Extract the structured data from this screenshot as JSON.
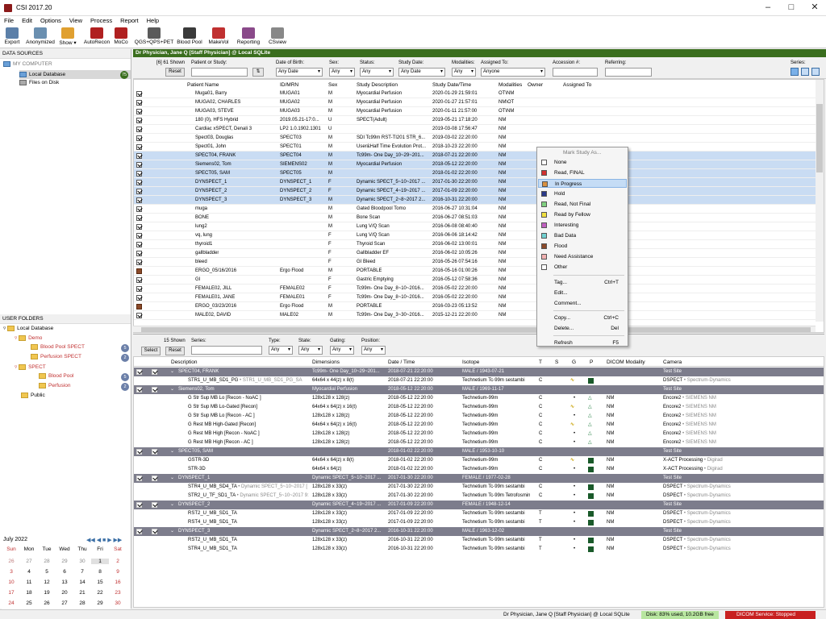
{
  "window": {
    "title": "CSI 2017.20"
  },
  "menu": [
    "File",
    "Edit",
    "Options",
    "View",
    "Process",
    "Report",
    "Help"
  ],
  "toolbar": [
    {
      "label": "Export",
      "color": "#5b7fa8"
    },
    {
      "label": "Anonymized",
      "color": "#6a8fb0"
    },
    {
      "label": "Show",
      "color": "#e0a030"
    },
    {
      "label": "AutoRecon",
      "color": "#b02020"
    },
    {
      "label": "MoCo",
      "color": "#b02020"
    },
    {
      "label": "QGS+QPS+PET",
      "color": "#5a5a5a"
    },
    {
      "label": "Blood Pool",
      "color": "#3a3a3a"
    },
    {
      "label": "MakeVol",
      "color": "#c03030"
    },
    {
      "label": "Reporting",
      "color": "#8a4a8a"
    },
    {
      "label": "CSview",
      "color": "#888"
    }
  ],
  "left": {
    "data_sources": "DATA SOURCES",
    "my_computer": "MY COMPUTER",
    "local_db": "Local Database",
    "local_db_count": "75",
    "files_on_disk": "Files on Disk",
    "user_folders": "USER FOLDERS",
    "folders": [
      {
        "label": "Local Database",
        "lvl": 0
      },
      {
        "label": "Demo",
        "lvl": 1
      },
      {
        "label": "Blood Pool SPECT",
        "lvl": 2,
        "count": "5"
      },
      {
        "label": "Perfusion SPECT",
        "lvl": 2,
        "count": "2"
      },
      {
        "label": "SPECT",
        "lvl": 1
      },
      {
        "label": "Blood Pool",
        "lvl": 2,
        "count": "5"
      },
      {
        "label": "Perfusion",
        "lvl": 2,
        "count": "2"
      },
      {
        "label": "Public",
        "lvl": 1
      }
    ]
  },
  "calendar": {
    "month": "July 2022",
    "days": [
      "Sun",
      "Mon",
      "Tue",
      "Wed",
      "Thu",
      "Fri",
      "Sat"
    ],
    "weeks": [
      [
        "26",
        "27",
        "28",
        "29",
        "30",
        "1",
        "2"
      ],
      [
        "3",
        "4",
        "5",
        "6",
        "7",
        "8",
        "9"
      ],
      [
        "10",
        "11",
        "12",
        "13",
        "14",
        "15",
        "16"
      ],
      [
        "17",
        "18",
        "19",
        "20",
        "21",
        "22",
        "23"
      ],
      [
        "24",
        "25",
        "26",
        "27",
        "28",
        "29",
        "30"
      ]
    ]
  },
  "banner": "Dr Physician, Jane Q [Staff Physician] @ Local SQLite",
  "filters": {
    "shown": "[6] 61 Shown",
    "reset": "Reset",
    "patient_label": "Patient or Study:",
    "dob_label": "Date of Birth:",
    "dob_val": "Any Date",
    "sex_label": "Sex:",
    "sex_val": "Any",
    "status_label": "Status:",
    "status_val": "Any",
    "sdate_label": "Study Date:",
    "sdate_val": "Any Date",
    "mod_label": "Modalities:",
    "mod_val": "Any",
    "assigned_label": "Assigned To:",
    "assigned_val": "Anyone",
    "acc_label": "Accession #:",
    "ref_label": "Referring:",
    "series_label": "Series:"
  },
  "columns": [
    "Patient Name",
    "ID/MRN",
    "Sex",
    "Study Description",
    "Study Date/Time",
    "Modalities",
    "Owner",
    "Assigned To"
  ],
  "rows": [
    {
      "name": "Muga01, Barry",
      "id": "MUGA01",
      "sex": "M",
      "desc": "Myocardial Perfusion",
      "date": "2020-01-29 21:59:01",
      "mod": "OT\\NM"
    },
    {
      "name": "MUGA02, CHARLES",
      "id": "MUGA02",
      "sex": "M",
      "desc": "Myocardial Perfusion",
      "date": "2020-01-27 21:57:01",
      "mod": "NM\\OT"
    },
    {
      "name": "MUGA03, STEVE",
      "id": "MUGA03",
      "sex": "M",
      "desc": "Myocardial Perfusion",
      "date": "2020-01-11 21:57:00",
      "mod": "OT\\NM"
    },
    {
      "name": "180 (0), HFS Hybrid",
      "id": "2019.05.21-17:0...",
      "sex": "U",
      "desc": "SPECT(Adult)",
      "date": "2019-05-21 17:18:20",
      "mod": "NM"
    },
    {
      "name": "Cardiac xSPECT, Denali 3",
      "id": "LP2 1.0.1902.1301",
      "sex": "U",
      "desc": "",
      "date": "2019-03-08 17:56:47",
      "mod": "NM"
    },
    {
      "name": "Spect03, Douglas",
      "id": "SPECT03",
      "sex": "M",
      "desc": "SDI Tc99m RST-TI201 STR_6...",
      "date": "2019-03-02 22:20:00",
      "mod": "NM"
    },
    {
      "name": "Spect01, John",
      "id": "SPECT01",
      "sex": "M",
      "desc": "User&Half Time Evolution Prot...",
      "date": "2018-10-23 22:20:00",
      "mod": "NM"
    },
    {
      "name": "SPECT04, FRANK",
      "id": "SPECT04",
      "sex": "M",
      "desc": "Tc99m- One Day_10~29~201...",
      "date": "2018-07-21 22:20:00",
      "mod": "NM",
      "sel": true
    },
    {
      "name": "Siemens02, Tom",
      "id": "SIEMENS02",
      "sex": "M",
      "desc": "Myocardial Perfusion",
      "date": "2018-05-12 22:20:00",
      "mod": "NM",
      "sel": true
    },
    {
      "name": "SPECT05, SAM",
      "id": "SPECT05",
      "sex": "M",
      "desc": "",
      "date": "2018-01-02 22:20:00",
      "mod": "NM",
      "sel": true
    },
    {
      "name": "DYNSPECT_1",
      "id": "DYNSPECT_1",
      "sex": "F",
      "desc": "Dynamic SPECT_5~10~2017 ...",
      "date": "2017-01-30 22:20:00",
      "mod": "NM",
      "sel": true
    },
    {
      "name": "DYNSPECT_2",
      "id": "DYNSPECT_2",
      "sex": "F",
      "desc": "Dynamic SPECT_4~19~2017 ...",
      "date": "2017-01-09 22:20:00",
      "mod": "NM",
      "sel": true
    },
    {
      "name": "DYNSPECT_3",
      "id": "DYNSPECT_3",
      "sex": "M",
      "desc": "Dynamic SPECT_2~8~2017 2...",
      "date": "2016-10-31 22:20:00",
      "mod": "NM",
      "sel": true
    },
    {
      "name": "muga",
      "id": "",
      "sex": "M",
      "desc": "Gated Bloodpool Tomo",
      "date": "2016-06-27 10:31:04",
      "mod": "NM"
    },
    {
      "name": "BONE",
      "id": "",
      "sex": "M",
      "desc": "Bone Scan",
      "date": "2016-06-27 08:51:03",
      "mod": "NM"
    },
    {
      "name": "lung2",
      "id": "",
      "sex": "M",
      "desc": "Lung V/Q Scan",
      "date": "2016-06-08 08:40:40",
      "mod": "NM"
    },
    {
      "name": "vq, lung",
      "id": "",
      "sex": "F",
      "desc": "Lung V/Q Scan",
      "date": "2016-06-06 18:14:42",
      "mod": "NM"
    },
    {
      "name": "thyroid1",
      "id": "",
      "sex": "F",
      "desc": "Thyroid Scan",
      "date": "2016-06-02 13:00:01",
      "mod": "NM"
    },
    {
      "name": "gallbladder",
      "id": "",
      "sex": "F",
      "desc": "Gallbladder EF",
      "date": "2016-06-02 10:05:26",
      "mod": "NM"
    },
    {
      "name": "bleed",
      "id": "",
      "sex": "F",
      "desc": "GI Bleed",
      "date": "2016-05-26 07:54:16",
      "mod": "NM"
    },
    {
      "name": "ERGO_05/16/2016",
      "id": "Ergo Flood",
      "sex": "M",
      "desc": "PORTABLE",
      "date": "2016-05-16 01:00:26",
      "mod": "NM",
      "brown": true
    },
    {
      "name": "GI",
      "id": "",
      "sex": "F",
      "desc": "Gastric Emptying",
      "date": "2016-05-12 07:58:36",
      "mod": "NM"
    },
    {
      "name": "FEMALE02, JILL",
      "id": "FEMALE02",
      "sex": "F",
      "desc": "Tc99m- One Day_8~10~2016...",
      "date": "2016-05-02 22:20:00",
      "mod": "NM"
    },
    {
      "name": "FEMALE01, JANE",
      "id": "FEMALE01",
      "sex": "F",
      "desc": "Tc99m- One Day_8~10~2016...",
      "date": "2016-05-02 22:20:00",
      "mod": "NM"
    },
    {
      "name": "ERGO_03/23/2016",
      "id": "Ergo Flood",
      "sex": "M",
      "desc": "PORTABLE",
      "date": "2016-03-23 05:13:52",
      "mod": "NM",
      "brown": true
    },
    {
      "name": "MALE02, DAVID",
      "id": "MALE02",
      "sex": "M",
      "desc": "Tc99m- One Day_3~30~2016...",
      "date": "2015-12-21 22:20:00",
      "mod": "NM"
    }
  ],
  "context_menu": {
    "header": "Mark Study As...",
    "marks": [
      {
        "label": "None",
        "color": "#ffffff"
      },
      {
        "label": "Read, FINAL",
        "color": "#d03030"
      },
      {
        "label": "In Progress",
        "color": "#d89040",
        "hl": true
      },
      {
        "label": "Hold",
        "color": "#2a3a8a"
      },
      {
        "label": "Read, Not Final",
        "color": "#80d080"
      },
      {
        "label": "Read by Fellow",
        "color": "#f0e040"
      },
      {
        "label": "Interesting",
        "color": "#c060c0"
      },
      {
        "label": "Bad Data",
        "color": "#70d0d0"
      },
      {
        "label": "Flood",
        "color": "#8b4a2a"
      },
      {
        "label": "Need Assistance",
        "color": "#f0b0b0"
      },
      {
        "label": "Other",
        "color": "#ffffff"
      }
    ],
    "actions": [
      {
        "label": "Tag...",
        "sc": "Ctrl+T"
      },
      {
        "label": "Edit...",
        "sc": ""
      },
      {
        "label": "Comment...",
        "sc": ""
      },
      {
        "label": "Copy...",
        "sc": "Ctrl+C"
      },
      {
        "label": "Delete...",
        "sc": "Del"
      },
      {
        "label": "Refresh",
        "sc": "F5"
      }
    ]
  },
  "lower_filters": {
    "shown": "15 Shown",
    "select": "Select",
    "reset": "Reset",
    "series_label": "Series:",
    "type_label": "Type:",
    "type_val": "Any",
    "state_label": "State:",
    "state_val": "Any",
    "gating_label": "Gating:",
    "gating_val": "Any",
    "position_label": "Position:",
    "position_val": "Any"
  },
  "series_columns": [
    "Description",
    "Dimensions",
    "Date / Time",
    "Isotope",
    "T",
    "S",
    "G",
    "P",
    "DICOM Modality",
    "Camera"
  ],
  "series": [
    {
      "grp": true,
      "desc": "SPECT04, FRANK",
      "dim": "Tc99m- One Day_10~29~201...",
      "date": "2018-07-21 22:20:00",
      "iso": "MALE / 1943-07-21",
      "cam": "Test Site"
    },
    {
      "desc": "STR1_U_MB_SD1_PG",
      "sub": "STR1_U_MB_SD1_PG_SA",
      "dim": "64x64 x 44(z) x 8(t)",
      "date": "2018-07-21 22:20:00",
      "iso": "Technetium Tc-99m sestambi",
      "t": "C",
      "g": "wave",
      "p": "g",
      "cam": "DSPECT",
      "camsub": "Spectrum-Dynamics"
    },
    {
      "grp": true,
      "desc": "Siemens02, Tom",
      "dim": "Myocardial Perfusion",
      "date": "2018-05-12 22:20:00",
      "iso": "MALE / 1969-11-17",
      "cam": "Test Site"
    },
    {
      "desc": "G Str Sup MB Lo [Recon - NoAC ]",
      "dim": "128x128 x 128(z)",
      "date": "2018-05-12 22:20:00",
      "iso": "Technetium-99m",
      "t": "C",
      "g": "dot",
      "p": "tri",
      "mod": "NM",
      "cam": "Encore2",
      "camsub": "SIEMENS NM"
    },
    {
      "desc": "G Str Sup MB Lo-Gated [Recon]",
      "dim": "64x64 x 64(z) x 16(t)",
      "date": "2018-05-12 22:20:00",
      "iso": "Technetium-99m",
      "t": "C",
      "g": "wave",
      "p": "tri",
      "mod": "NM",
      "cam": "Encore2",
      "camsub": "SIEMENS NM"
    },
    {
      "desc": "G Str Sup MB Lo [Recon - AC ]",
      "dim": "128x128 x 128(z)",
      "date": "2018-05-12 22:20:00",
      "iso": "Technetium-99m",
      "t": "C",
      "g": "dot",
      "p": "tri",
      "mod": "NM",
      "cam": "Encore2",
      "camsub": "SIEMENS NM"
    },
    {
      "desc": "G Rest MB High-Gated [Recon]",
      "dim": "64x64 x 64(z) x 16(t)",
      "date": "2018-05-12 22:20:00",
      "iso": "Technetium-99m",
      "t": "C",
      "g": "wave",
      "p": "tri",
      "mod": "NM",
      "cam": "Encore2",
      "camsub": "SIEMENS NM"
    },
    {
      "desc": "G Rest MB High [Recon - NoAC ]",
      "dim": "128x128 x 128(z)",
      "date": "2018-05-12 22:20:00",
      "iso": "Technetium-99m",
      "t": "C",
      "g": "dot",
      "p": "tri",
      "mod": "NM",
      "cam": "Encore2",
      "camsub": "SIEMENS NM"
    },
    {
      "desc": "G Rest MB High [Recon - AC ]",
      "dim": "128x128 x 128(z)",
      "date": "2018-05-12 22:20:00",
      "iso": "Technetium-99m",
      "t": "C",
      "g": "dot",
      "p": "tri",
      "mod": "NM",
      "cam": "Encore2",
      "camsub": "SIEMENS NM"
    },
    {
      "grp": true,
      "desc": "SPECT05, SAM",
      "dim": "",
      "date": "2018-01-02 22:20:00",
      "iso": "MALE / 1953-10-10",
      "cam": "Test Site"
    },
    {
      "desc": "GSTR-3D",
      "dim": "64x64 x 64(z) x 8(t)",
      "date": "2018-01-02 22:20:00",
      "iso": "Technetium-99m",
      "t": "C",
      "g": "wave",
      "p": "g",
      "mod": "NM",
      "cam": "X-ACT Processing",
      "camsub": "Digirad"
    },
    {
      "desc": "STR-3D",
      "dim": "64x64 x 64(z)",
      "date": "2018-01-02 22:20:00",
      "iso": "Technetium-99m",
      "t": "C",
      "g": "dot",
      "p": "g",
      "mod": "NM",
      "cam": "X-ACT Processing",
      "camsub": "Digirad"
    },
    {
      "grp": true,
      "desc": "DYNSPECT_1",
      "dim": "Dynamic SPECT_5~10~2017 ...",
      "date": "2017-01-30 22:20:00",
      "iso": "FEMALE / 1977-02-28",
      "cam": "Test Site"
    },
    {
      "desc": "STR4_U_MB_SD4_TA",
      "sub": "Dynamic SPECT_5~10~2017 [",
      "dim": "128x128 x 33(z)",
      "date": "2017-01-30 22:20:00",
      "iso": "Technetium Tc-99m sestambi",
      "t": "C",
      "g": "dot",
      "p": "g",
      "mod": "NM",
      "cam": "DSPECT",
      "camsub": "Spectrum-Dynamics"
    },
    {
      "desc": "STR2_U_TF_SD1_TA",
      "sub": "Dynamic SPECT_5~10~2017 9:",
      "dim": "128x128 x 33(z)",
      "date": "2017-01-30 22:20:00",
      "iso": "Technetium Tc-99m Tetrofosmin",
      "t": "C",
      "g": "dot",
      "p": "g",
      "mod": "NM",
      "cam": "DSPECT",
      "camsub": "Spectrum-Dynamics"
    },
    {
      "grp": true,
      "desc": "DYNSPECT_2",
      "dim": "Dynamic SPECT_4~19~2017 ...",
      "date": "2017-01-09 22:20:00",
      "iso": "FEMALE / 1948-12-14",
      "cam": "Test Site"
    },
    {
      "desc": "RST2_U_MB_SD1_TA",
      "dim": "128x128 x 33(z)",
      "date": "2017-01-09 22:20:00",
      "iso": "Technetium Tc-99m sestambi",
      "t": "T",
      "g": "dot",
      "p": "g",
      "mod": "NM",
      "cam": "DSPECT",
      "camsub": "Spectrum-Dynamics"
    },
    {
      "desc": "RST4_U_MB_SD1_TA",
      "dim": "128x128 x 33(z)",
      "date": "2017-01-09 22:20:00",
      "iso": "Technetium Tc-99m sestambi",
      "t": "T",
      "g": "dot",
      "p": "g",
      "mod": "NM",
      "cam": "DSPECT",
      "camsub": "Spectrum-Dynamics"
    },
    {
      "grp": true,
      "desc": "DYNSPECT_3",
      "dim": "Dynamic SPECT_2~8~2017 2...",
      "date": "2016-10-31 22:20:00",
      "iso": "MALE / 1963-12-02",
      "cam": "Test Site"
    },
    {
      "desc": "RST2_U_MB_SD1_TA",
      "dim": "128x128 x 33(z)",
      "date": "2016-10-31 22:20:00",
      "iso": "Technetium Tc-99m sestambi",
      "t": "T",
      "g": "dot",
      "p": "g",
      "mod": "NM",
      "cam": "DSPECT",
      "camsub": "Spectrum-Dynamics"
    },
    {
      "desc": "STR4_U_MB_SD1_TA",
      "dim": "128x128 x 33(z)",
      "date": "2016-10-31 22:20:00",
      "iso": "Technetium Tc-99m sestambi",
      "t": "T",
      "g": "dot",
      "p": "g",
      "mod": "NM",
      "cam": "DSPECT",
      "camsub": "Spectrum-Dynamics"
    }
  ],
  "status": {
    "user": "Dr Physician, Jane Q [Staff Physician] @ Local SQLite",
    "disk": "Disk: 83% used, 10.2GB free",
    "dicom": "DICOM Service: Stopped"
  }
}
